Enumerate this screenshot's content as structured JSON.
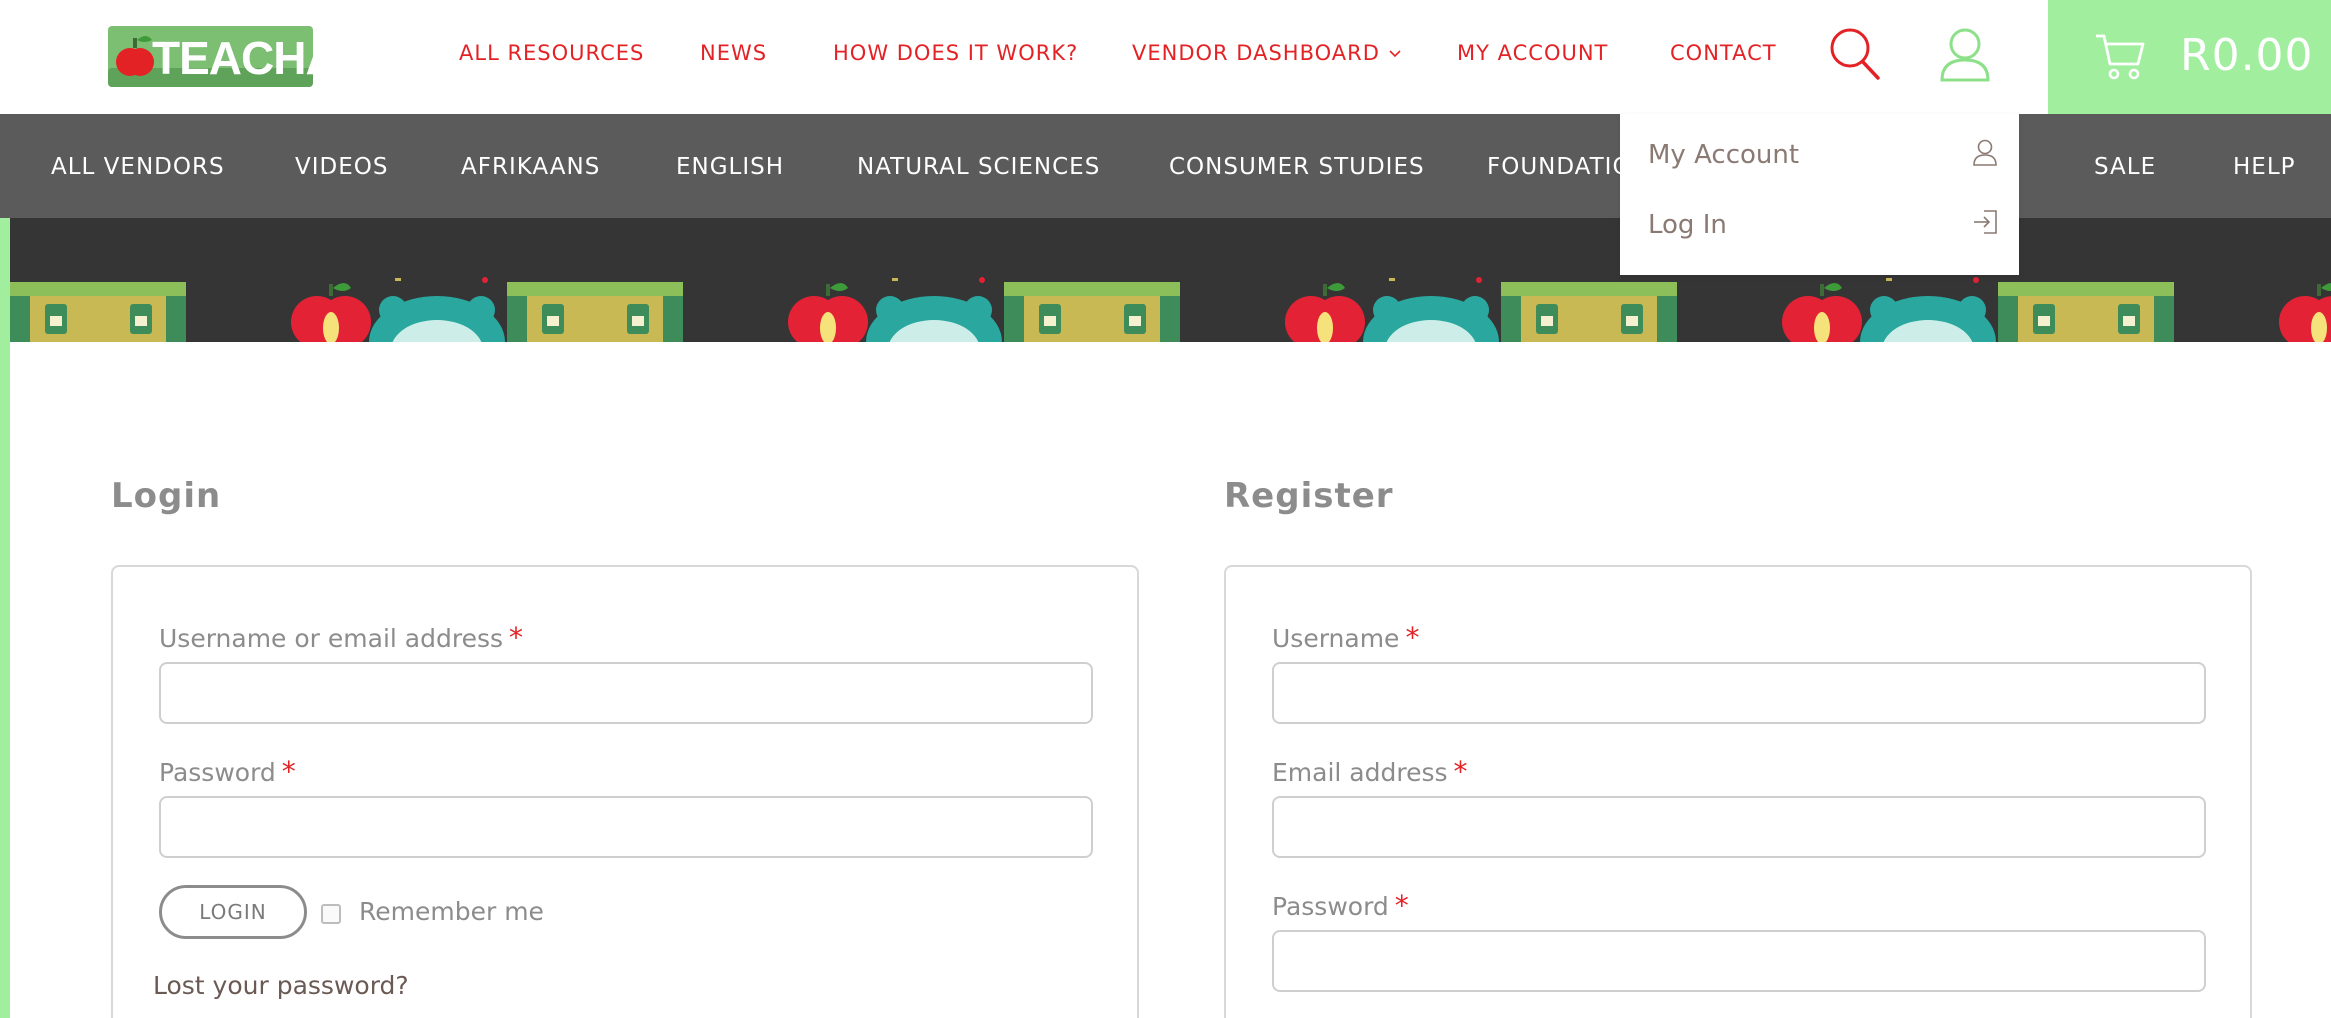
{
  "header": {
    "logo_text": "TEACHA!",
    "nav": [
      {
        "label": "ALL RESOURCES"
      },
      {
        "label": "NEWS"
      },
      {
        "label": "HOW DOES IT WORK?"
      },
      {
        "label": "VENDOR DASHBOARD",
        "has_dropdown": true
      },
      {
        "label": "MY ACCOUNT"
      },
      {
        "label": "CONTACT"
      }
    ],
    "icons": {
      "search": "search-icon",
      "account": "user-icon",
      "cart": "cart-icon"
    },
    "cart_total": "R0.00"
  },
  "categories": [
    {
      "label": "ALL VENDORS"
    },
    {
      "label": "VIDEOS"
    },
    {
      "label": "AFRIKAANS"
    },
    {
      "label": "ENGLISH"
    },
    {
      "label": "NATURAL SCIENCES"
    },
    {
      "label": "CONSUMER STUDIES"
    },
    {
      "label": "FOUNDATIC"
    },
    {
      "label": "SALE"
    },
    {
      "label": "HELP"
    }
  ],
  "account_dropdown": {
    "items": [
      {
        "label": "My Account",
        "icon": "user-icon"
      },
      {
        "label": "Log In",
        "icon": "login-icon"
      }
    ]
  },
  "login": {
    "title": "Login",
    "username_label": "Username or email address",
    "password_label": "Password",
    "required_mark": "*",
    "username_value": "",
    "password_value": "",
    "submit_label": "LOGIN",
    "remember_label": "Remember me",
    "remember_checked": false,
    "lost_password_label": "Lost your password?"
  },
  "register": {
    "title": "Register",
    "username_label": "Username",
    "email_label": "Email address",
    "password_label": "Password",
    "required_mark": "*",
    "username_value": "",
    "email_value": "",
    "password_value": ""
  },
  "colors": {
    "accent_red": "#e32226",
    "accent_green": "#a2ee9f",
    "category_bar": "#5b5b5b",
    "banner_bg": "#353535"
  }
}
